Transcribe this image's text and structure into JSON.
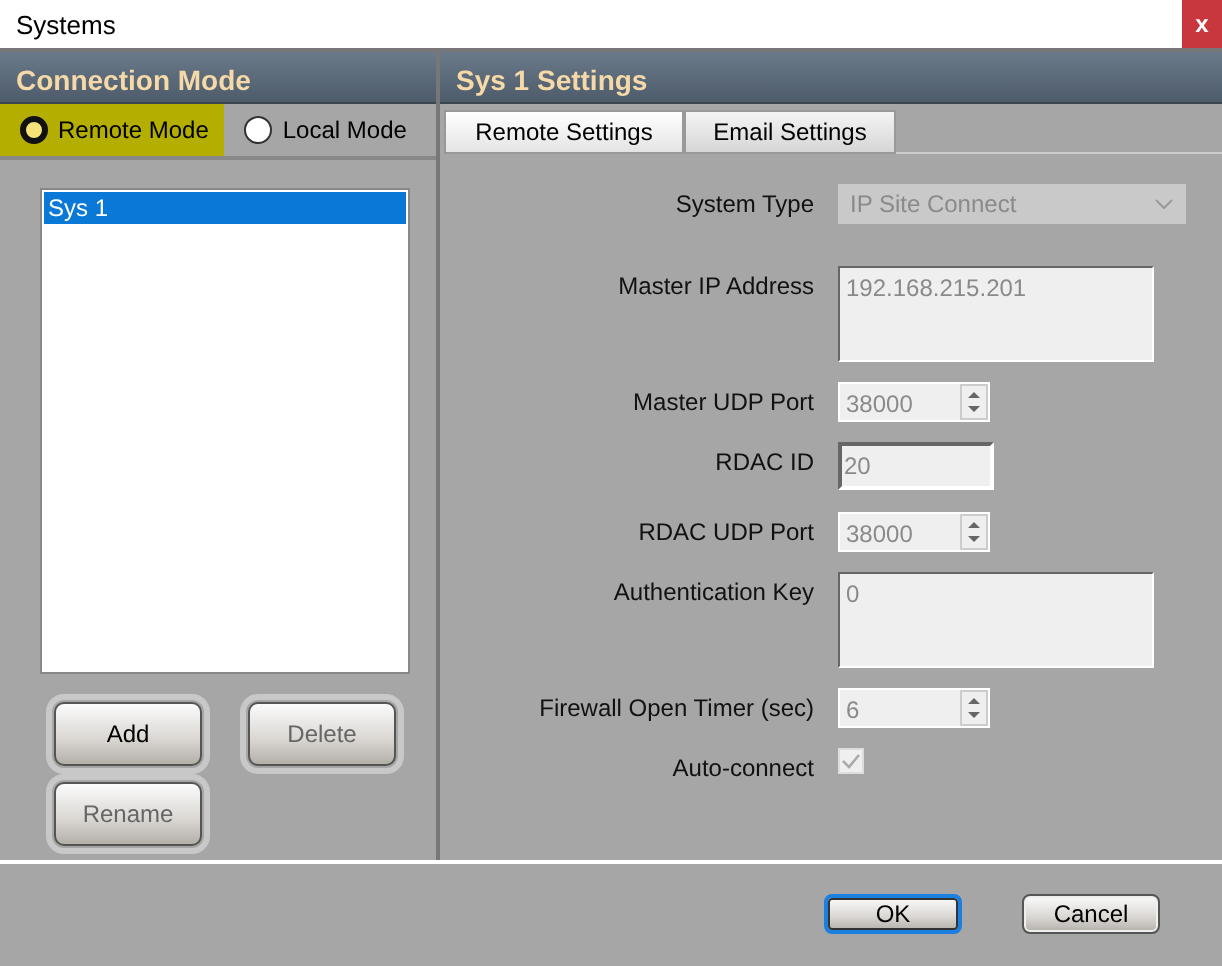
{
  "window": {
    "title": "Systems",
    "close": "x"
  },
  "connection_mode": {
    "title": "Connection Mode",
    "options": [
      {
        "label": "Remote Mode",
        "selected": true
      },
      {
        "label": "Local Mode",
        "selected": false
      }
    ]
  },
  "systems_list": {
    "items": [
      {
        "label": "Sys 1",
        "selected": true
      }
    ]
  },
  "list_buttons": [
    {
      "label": "Add",
      "disabled": false
    },
    {
      "label": "Delete",
      "disabled": true
    },
    {
      "label": "Rename",
      "disabled": true
    }
  ],
  "settings": {
    "title": "Sys 1 Settings",
    "tabs": [
      {
        "label": "Remote Settings",
        "selected": true
      },
      {
        "label": "Email Settings",
        "selected": false
      }
    ],
    "fields": [
      {
        "kind": "select",
        "label": "System Type",
        "value": "IP Site Connect"
      },
      {
        "kind": "textarea",
        "label": "Master IP Address",
        "value": "192.168.215.201"
      },
      {
        "kind": "spin",
        "label": "Master UDP Port",
        "value": "38000"
      },
      {
        "kind": "text",
        "label": "RDAC ID",
        "value": "20"
      },
      {
        "kind": "spin",
        "label": "RDAC UDP Port",
        "value": "38000"
      },
      {
        "kind": "textarea",
        "label": "Authentication Key",
        "value": "0"
      },
      {
        "kind": "spin",
        "label": "Firewall Open Timer (sec)",
        "value": "6"
      },
      {
        "kind": "checkbox",
        "label": "Auto-connect",
        "checked": true
      }
    ]
  },
  "buttons": [
    {
      "label": "OK",
      "focused": true
    },
    {
      "label": "Cancel",
      "focused": false
    }
  ]
}
